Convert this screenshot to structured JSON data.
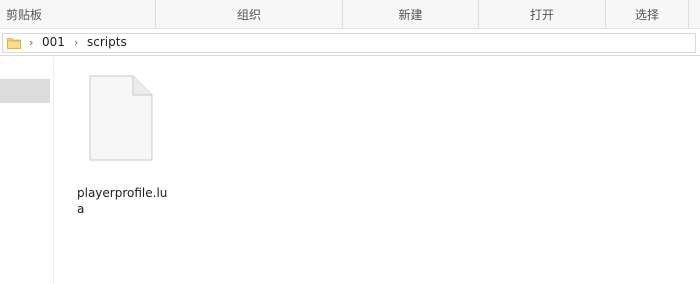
{
  "ribbon": {
    "groups": [
      "剪贴板",
      "组织",
      "新建",
      "打开",
      "选择"
    ]
  },
  "address": {
    "crumbs": [
      "001",
      "scripts"
    ]
  },
  "files": [
    {
      "name": "playerprofile.lua",
      "icon": "file-icon"
    }
  ]
}
